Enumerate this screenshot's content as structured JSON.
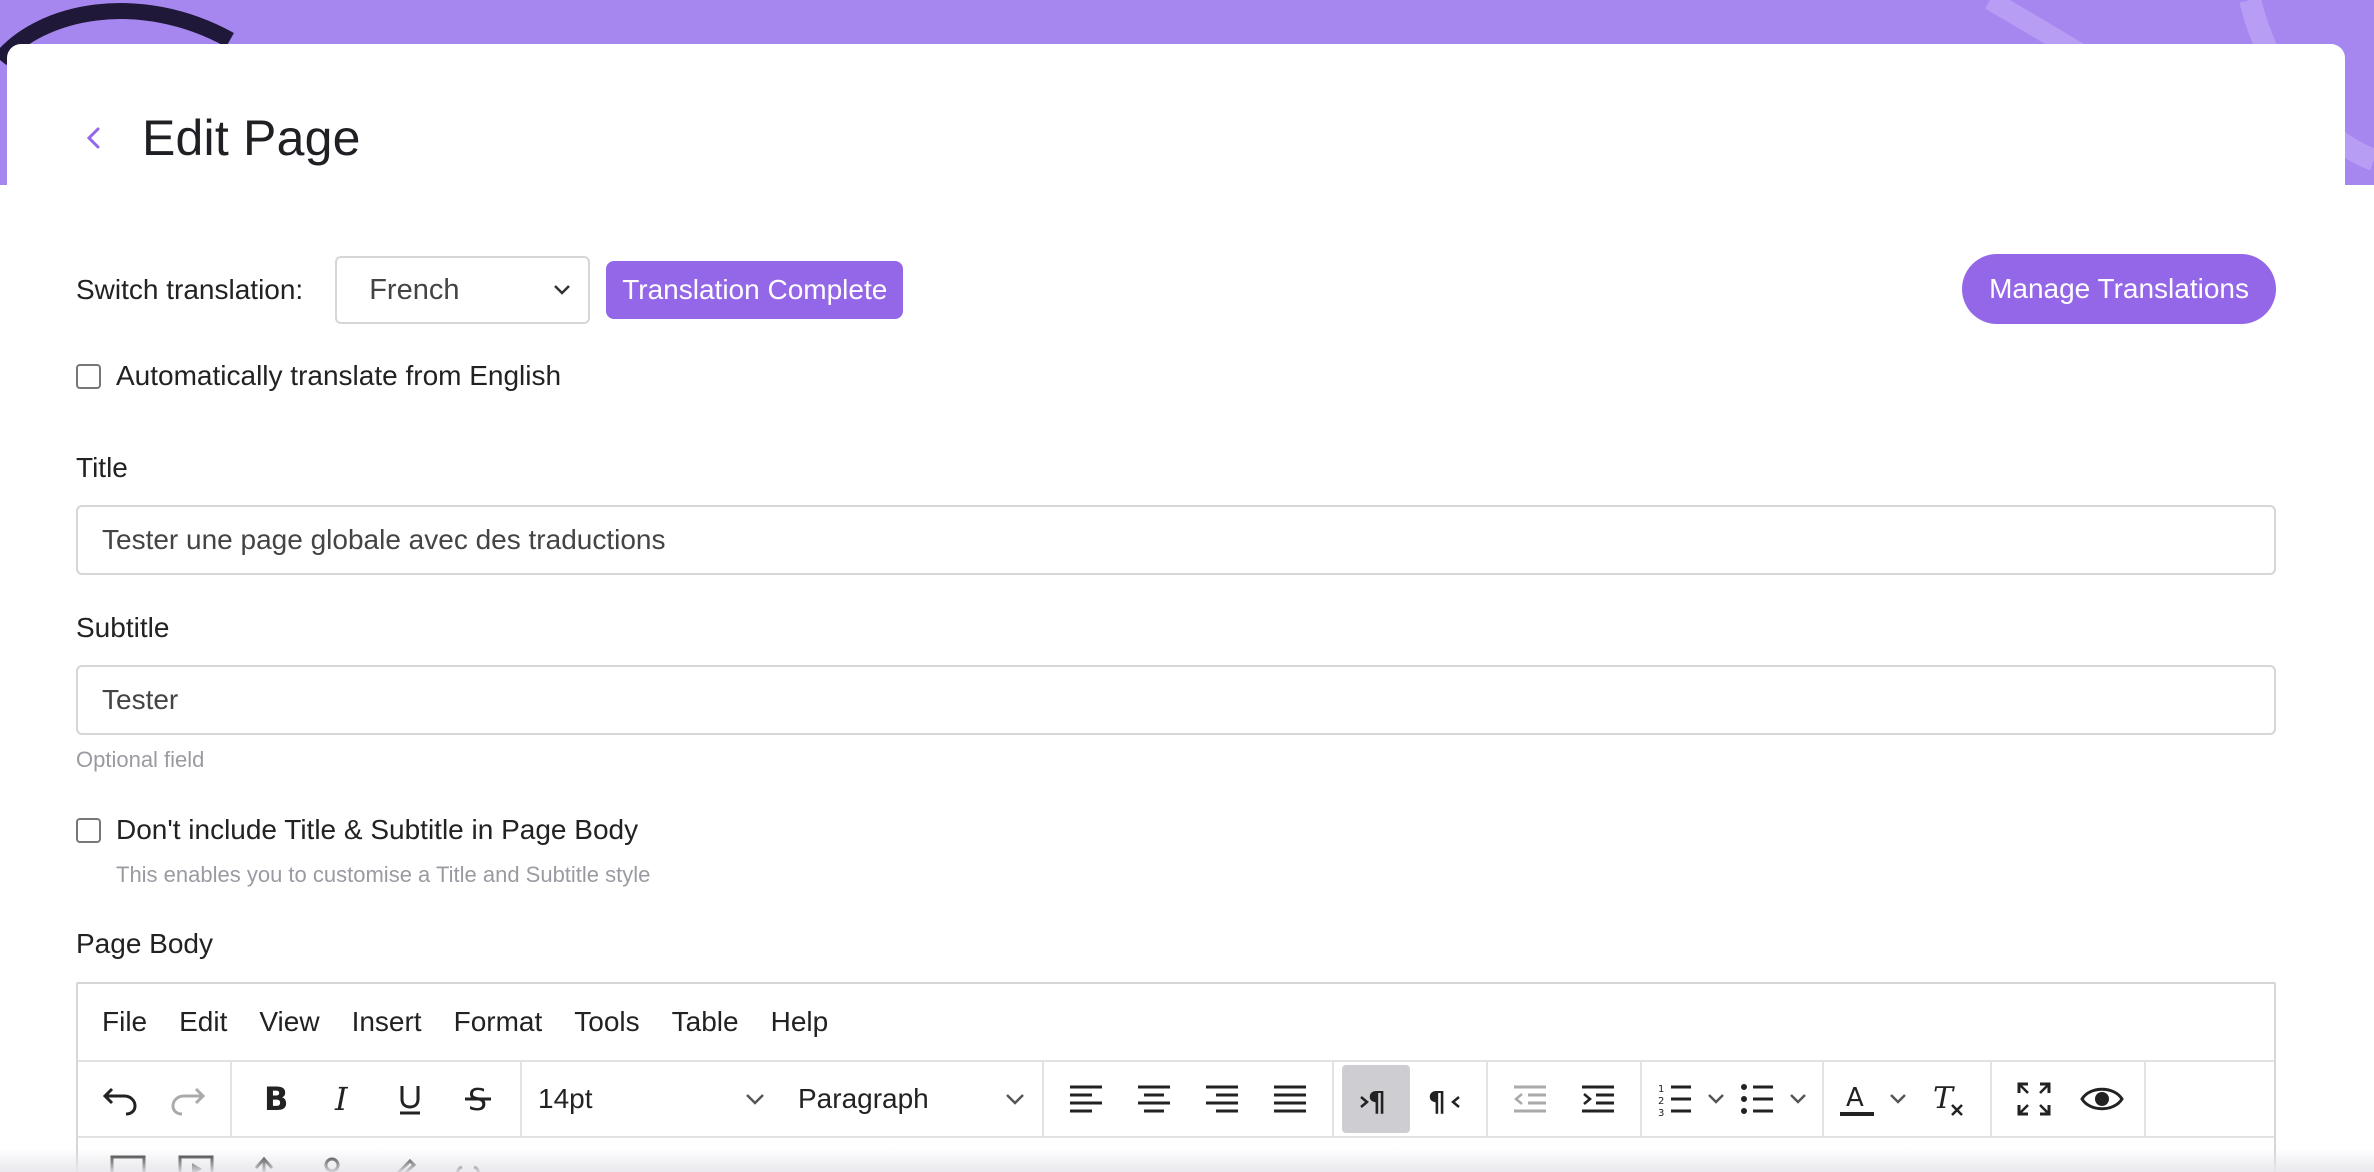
{
  "page": {
    "title": "Edit Page",
    "accent": "#9466e8",
    "banner_color": "#a587ef"
  },
  "translation": {
    "switch_label": "Switch translation:",
    "selected_language": "French",
    "status_badge": "Translation Complete",
    "manage_button": "Manage Translations",
    "auto_translate_label": "Automatically translate from English",
    "auto_translate_checked": false
  },
  "fields": {
    "title_label": "Title",
    "title_value": "Tester une page globale avec des traductions",
    "subtitle_label": "Subtitle",
    "subtitle_value": "Tester",
    "subtitle_help": "Optional field",
    "exclude_title_label": "Don't include Title & Subtitle in Page Body",
    "exclude_title_help": "This enables you to customise a Title and Subtitle style",
    "exclude_title_checked": false
  },
  "editor": {
    "label": "Page Body",
    "menu": [
      "File",
      "Edit",
      "View",
      "Insert",
      "Format",
      "Tools",
      "Table",
      "Help"
    ],
    "font_size": "14pt",
    "block_format": "Paragraph",
    "toolbar_icons": [
      "undo-icon",
      "redo-icon",
      "bold-icon",
      "italic-icon",
      "underline-icon",
      "strikethrough-icon",
      "align-left-icon",
      "align-center-icon",
      "align-right-icon",
      "align-justify-icon",
      "ltr-icon",
      "rtl-icon",
      "outdent-icon",
      "indent-icon",
      "numbered-list-icon",
      "bullet-list-icon",
      "text-color-icon",
      "clear-formatting-icon",
      "fullscreen-icon",
      "preview-icon"
    ]
  }
}
